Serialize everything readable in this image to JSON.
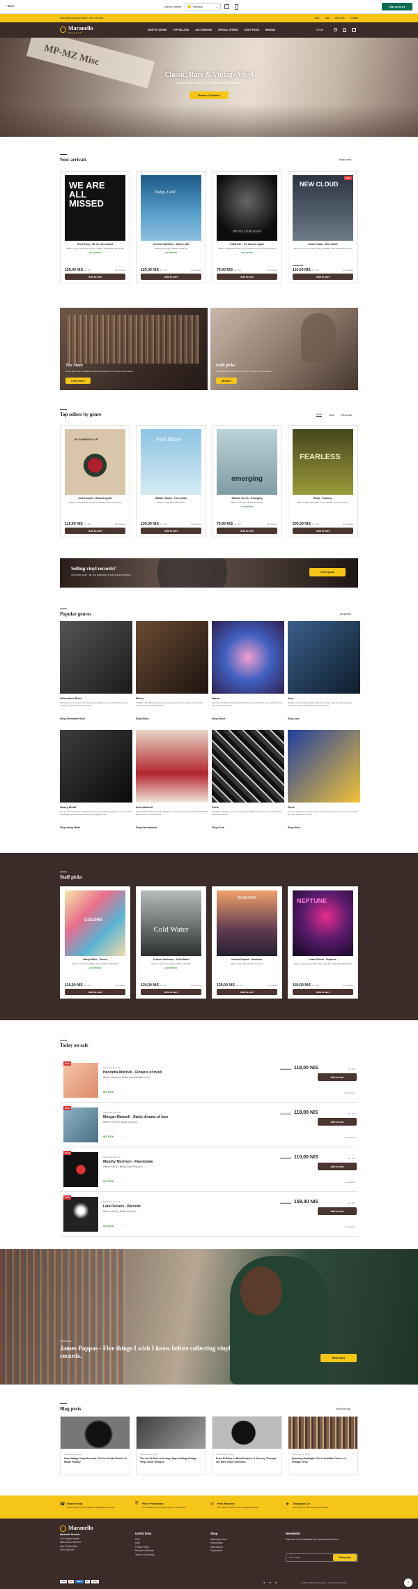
{
  "theme_bar": {
    "back": "Back",
    "theme_label": "Theme preset:",
    "preset": "Records",
    "signup": "Sign up to try"
  },
  "announce": {
    "left": "Emergency support hotline: +00 0 000 000",
    "links": [
      "FAQ",
      "Help",
      "About Us",
      "Contact"
    ]
  },
  "header": {
    "logo": "Maranello",
    "logo_sub": "RECORDS",
    "nav": [
      "SHOP BY GENRE",
      "TOP SELLERS",
      "JUST ARRIVED",
      "SPECIAL OFFERS",
      "STAFF PICKS",
      "BRANDS"
    ],
    "locale": "€ EUR"
  },
  "hero": {
    "title": "Classic, Rare & Vintage Vinyl",
    "subtitle": "Take Into the Golden Era - Exceptional Records Await",
    "cta": "Browse Collection",
    "sign": "MP-MZ Misc"
  },
  "new_arrivals": {
    "title": "New arrivals",
    "show_more": "Show more",
    "products": [
      {
        "name": "Drew Ferg - We are all missed",
        "meta": "Sleeve: Very Good Plus (VG+), Media: Near Mint (NM or M-)",
        "stock": "IN STOCK",
        "price": "159,00 NIS",
        "tax": "inc. VAT",
        "reviews": "No reviews",
        "btn": "Add to cart",
        "cover_text": "WE ARE ALL MISSED",
        "badge": ""
      },
      {
        "name": "Connor Hamilton - Today I will",
        "meta": "Sleeve: Poor (P), Media: Good (G)",
        "stock": "IN STOCK",
        "price": "125,00 NIS",
        "tax": "inc. VAT",
        "reviews": "No reviews",
        "btn": "Add to cart",
        "cover_text": "Today, I will.",
        "badge": ""
      },
      {
        "name": "Chidi Eze - Try all over again",
        "meta": "Sleeve: Near Mint (NM or M-), Media: Very Good Plus (VG+)",
        "stock": "IN STOCK",
        "price": "79,00 NIS",
        "tax": "inc. VAT",
        "reviews": "No reviews",
        "btn": "Add to cart",
        "cover_text": "TRY ALL OVER AGAIN",
        "badge": ""
      },
      {
        "name": "Chase Gallo - New cloud",
        "meta": "Sleeve: Very Good Plus (VG+), Media: Very Good Plus (VG+)",
        "stock": "",
        "price": "110,00 NIS",
        "old_price": "129,00 NIS",
        "tax": "inc. VAT",
        "reviews": "No reviews",
        "btn": "Add to cart",
        "cover_text": "NEW CLOUD",
        "badge": "SALE"
      }
    ]
  },
  "promo": {
    "store_title": "The Store",
    "store_text": "Come visit us at our flagship store and experience vinyl like never before.",
    "store_btn": "Learn more",
    "staff_title": "Staff picks",
    "staff_text": "Handpicked favorites from our staff - vintage vinyl treasures.",
    "staff_btn": "Browse"
  },
  "top_sellers": {
    "title": "Top sellers by genre",
    "tabs": [
      "Rock",
      "Jazz",
      "Electronic"
    ],
    "products": [
      {
        "name": "Soleil Austin - Bloomingville",
        "meta": "Sleeve: Very Good Plus (VG+), Media: Very Good (VG)",
        "stock": "",
        "price": "119,00 NIS",
        "tax": "inc. VAT",
        "reviews": "No reviews",
        "btn": "Add to cart",
        "cover_text": "BLOOMINGVILLE"
      },
      {
        "name": "Natalie Haisen - Feel better",
        "meta": "Sleeve: Near Mint (NM or M-)",
        "stock": "",
        "price": "139,00 NIS",
        "tax": "inc. VAT",
        "reviews": "No reviews",
        "btn": "Add to cart",
        "cover_text": "Feel Better"
      },
      {
        "name": "Alfredo Torres - Emerging",
        "meta": "Sleeve: Fair (F), Media: Good (G)",
        "stock": "IN STOCK",
        "price": "79,00 NIS",
        "tax": "inc. VAT",
        "reviews": "No reviews",
        "btn": "Add to cart",
        "cover_text": "emerging"
      },
      {
        "name": "Brian - Fearless",
        "meta": "Sleeve: Near Mint (NM or M-), Media: Good Plus (G+)",
        "stock": "",
        "price": "200,00 NIS",
        "tax": "inc. VAT",
        "reviews": "No reviews",
        "btn": "Add to cart",
        "cover_text": "FEARLESS"
      }
    ]
  },
  "sell_banner": {
    "title": "Selling vinyl records?",
    "text": "Get a free quote - we buy collections of every size and genre.",
    "btn": "Get a quote"
  },
  "genres": {
    "title": "Popular genres",
    "all": "All genres",
    "items": [
      {
        "name": "Alternative Rock",
        "desc": "Discover rare treasures from the genre's golden era, celebrated for its raw energy and groundbreaking sound.",
        "shop": "Shop Alternative Rock"
      },
      {
        "name": "Blues",
        "desc": "Indulge in the Blues. Discover vinyl treasures rich in emotion with soulful melodies and heartfelt rhythms.",
        "shop": "Shop Blues"
      },
      {
        "name": "Dance",
        "desc": "Groove into classic dancefloor anthems and iconic beats. Get ready to move with our curated picks.",
        "shop": "Shop Dance"
      },
      {
        "name": "Jazz",
        "desc": "Explore our carefully curated collection of rare Jazz records, featuring legendary artists and timeless performances.",
        "shop": "Shop Jazz"
      },
      {
        "name": "Heavy Metal",
        "desc": "Our curated collection of Heavy Metal records offers a glimpse into its world of headbanging anthems and electrifying guitar solos.",
        "shop": "Shop Heavy Metal"
      },
      {
        "name": "International",
        "desc": "From Italian Fashion to Latin Rhythms to the legendary melodies of the Middle East, we have you covered.",
        "shop": "Shop International"
      },
      {
        "name": "Punk",
        "desc": "Rebellious rhythms, raw energy and an attitude that never dies. Find classic punk albums here.",
        "shop": "Shop Punk"
      },
      {
        "name": "Rock",
        "desc": "Let the adventurous guitar solos and pounding drums take you on a journey through the history of rock.",
        "shop": "Shop Rock"
      }
    ]
  },
  "staff_picks": {
    "title": "Staff picks",
    "products": [
      {
        "name": "Hasty Miller - Colors",
        "meta": "Sleeve: Very Good Plus (VG+), Media: Mint (M)",
        "stock": "IN STOCK",
        "price": "119,00 NIS",
        "tax": "inc. VAT",
        "reviews": "No reviews",
        "btn": "Add to cart",
        "cover_text": "COLORS"
      },
      {
        "name": "Joshua Jamieson - Cold Water",
        "meta": "Sleeve: Very Good (VG), Media: Mint (M)",
        "stock": "IN STOCK",
        "price": "130,00 NIS",
        "tax": "inc. VAT",
        "reviews": "No reviews",
        "btn": "Add to cart",
        "cover_text": "Cold Water"
      },
      {
        "name": "Helena Paquet - Sundown",
        "meta": "Sleeve: Fair (F), Media: Good (G)",
        "stock": "",
        "price": "129,00 NIS",
        "tax": "inc. VAT",
        "reviews": "No reviews",
        "btn": "Add to cart",
        "cover_text": "SUNDOWN"
      },
      {
        "name": "Isaac Rivers - Neptune",
        "meta": "Sleeve: Very Good Plus (VG+), Media: Near Mint (NM or M-)",
        "stock": "",
        "price": "149,00 NIS",
        "tax": "inc. VAT",
        "reviews": "No reviews",
        "btn": "Add to cart",
        "cover_text": "NEPTUNE"
      }
    ]
  },
  "sale": {
    "title": "Today on sale",
    "items": [
      {
        "vendor": "Maranello Records",
        "name": "Henrietta Mitchell - Flowers of mind",
        "meta": "Sleeve: Good (G), Media: Near Mint (NM or M-)",
        "stock": "IN STOCK",
        "old": "135,00 NIS",
        "price": "118,00 NIS",
        "tax": "inc. VAT",
        "btn": "Add to cart",
        "reviews": "No reviews"
      },
      {
        "vendor": "Maranello Records",
        "name": "Morgan Maxwell - Static dreams of love",
        "meta": "Sleeve: Poor (P), Media: Good (G)",
        "stock": "IN STOCK",
        "old": "135,00 NIS",
        "price": "118,00 NIS",
        "tax": "inc. VAT",
        "btn": "Add to cart",
        "reviews": "No reviews"
      },
      {
        "vendor": "Maranello Records",
        "name": "Murphy Morrison - Passionate",
        "meta": "Sleeve: Fair (F), Media: Good Plus (G+)",
        "stock": "IN STOCK",
        "old": "135,00 NIS",
        "price": "110,00 NIS",
        "tax": "inc. VAT",
        "btn": "Add to cart",
        "reviews": "No reviews"
      },
      {
        "vendor": "Maranello Records",
        "name": "Lara Peeters - Barcelle",
        "meta": "Sleeve: Fair (F), Media: Good (G)",
        "stock": "IN STOCK",
        "old": "199,00 NIS",
        "price": "159,00 NIS",
        "tax": "inc. VAT",
        "btn": "Add to cart",
        "reviews": "No reviews"
      }
    ],
    "badge": "SALE"
  },
  "interview": {
    "kicker": "Interviews",
    "title": "James Pappas - Five things I wish I knew before collecting vinyl records.",
    "btn": "Read story"
  },
  "blog": {
    "title": "Blog posts",
    "link": "Visit our blog",
    "posts": [
      {
        "date": "September 1, 2025",
        "title": "How Vintage Vinyl Records Tell the Untold Stories of Music History"
      },
      {
        "date": "September 1, 2025",
        "title": "The Art of Slow Listening: Appreciating Vintage Vinyl Cover Designs"
      },
      {
        "date": "September 1, 2025",
        "title": "From B-Sides to Blockbusters: A Journey Through our Rare Vinyl Collection"
      },
      {
        "date": "September 1, 2025",
        "title": "Spinning Nostalgia: The Irresistible Charm of Vintage Vinyl"
      }
    ]
  },
  "features": [
    {
      "title": "Expert Help",
      "text": "Expert support for any question regarding our records"
    },
    {
      "title": "Price Protection",
      "text": "Find a lower price and we'll match it. Guaranteed."
    },
    {
      "title": "Free Returns",
      "text": "We make it simple to return, guaranteed return"
    },
    {
      "title": "Trustpilot 4.9",
      "text": "Over 1,000+ 5-star reviews on Trustpilot"
    }
  ],
  "footer": {
    "logo": "Maranello",
    "address": [
      "Maranello Records",
      "6-10 Hobart Parade",
      "Manchester, M8 3DH",
      "Mon-Fri 9am-5pm",
      "+00 0 000 000"
    ],
    "cols": [
      {
        "h": "Useful links",
        "items": [
          "FAQ",
          "Help",
          "Privacy Policy",
          "Returns & Refunds",
          "Terms & Conditions"
        ]
      },
      {
        "h": "Shop",
        "items": [
          "Alternative Rock",
          "Heavy Metal",
          "International",
          "Psychedelic"
        ]
      }
    ],
    "news_h": "Newsletter",
    "news_text": "Subscribe to our newsletter and receive special offers.",
    "news_ph": "Your email",
    "news_btn": "Subscribe",
    "payments": [
      "VISA",
      "MC",
      "AMEX",
      "PP",
      "GPay"
    ],
    "copyright": "© 2025, Maranello Records · Powered by Shopify"
  },
  "colors": {
    "brand_brown": "#3b2c29",
    "accent_yellow": "#f5c518",
    "green": "#2e8b2e",
    "sale_red": "#d93636"
  }
}
